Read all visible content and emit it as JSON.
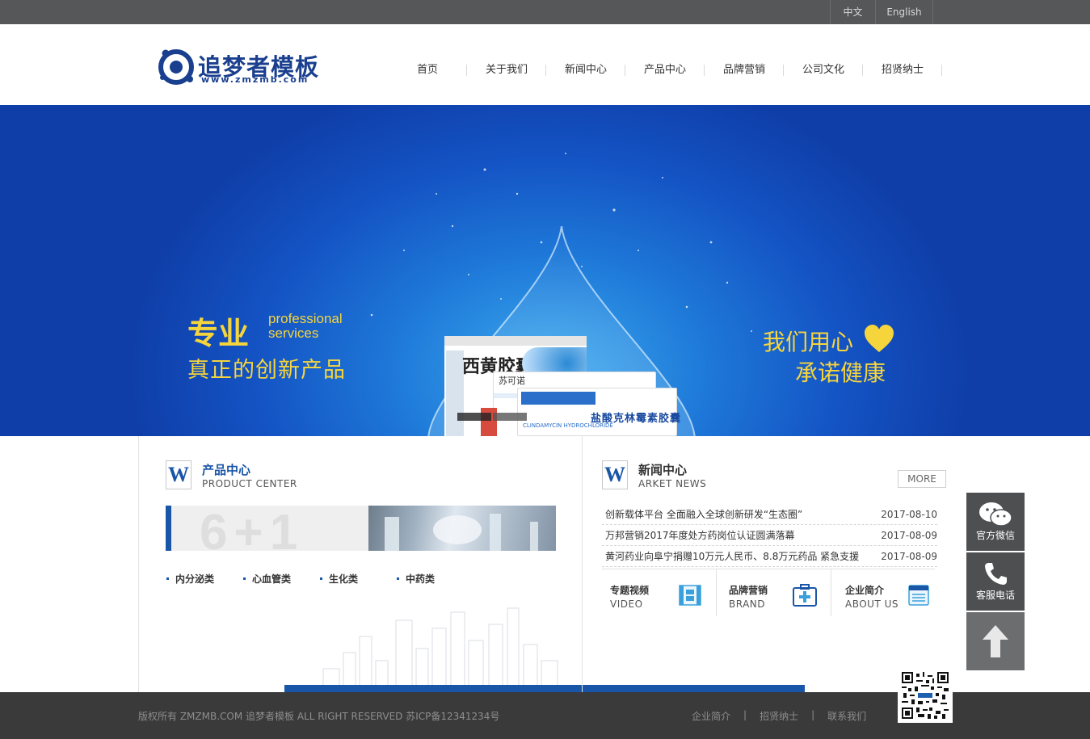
{
  "topbar": {
    "lang_zh": "中文",
    "lang_en": "English"
  },
  "header": {
    "logo_title": "追梦者模板",
    "logo_sub": "www.zmzmb.com",
    "nav": [
      "首页",
      "关于我们",
      "新闻中心",
      "产品中心",
      "品牌营销",
      "公司文化",
      "招贤纳士"
    ]
  },
  "banner": {
    "left_big": "专业",
    "left_en1": "professional",
    "left_en2": "services",
    "left_line2": "真正的创新产品",
    "right_line1": "我们用心",
    "right_line2": "承诺健康",
    "pkg1_name": "西黄胶囊",
    "pkg2_name": "苏可诺",
    "pkg3_name": "盐酸克林霉素胶囊",
    "pkg3_en": "CLINDAMYCIN HYDROCHLORIDE",
    "slides": 2,
    "active_slide": 1,
    "colors": {
      "accent": "#f6d53c",
      "bg_deep": "#0f3ea8",
      "bg_light": "#3aa8ee"
    }
  },
  "products": {
    "icon_letter": "W",
    "title": "产品中心",
    "subtitle": "PRODUCT CENTER",
    "banner_text": "6+1",
    "categories": [
      "内分泌类",
      "心血管类",
      "生化类",
      "中药类"
    ]
  },
  "news": {
    "icon_letter": "W",
    "title": "新闻中心",
    "subtitle": "ARKET NEWS",
    "more": "MORE",
    "items": [
      {
        "title": "创新载体平台 全面融入全球创新研发“生态圈”",
        "date": "2017-08-10"
      },
      {
        "title": "万邦营销2017年度处方药岗位认证圆满落幕",
        "date": "2017-08-09"
      },
      {
        "title": "黄河药业向阜宁捐赠10万元人民币、8.8万元药品 紧急支援",
        "date": "2017-08-09"
      }
    ],
    "links": [
      {
        "zh": "专题视频",
        "en": "VIDEO",
        "icon": "film-icon"
      },
      {
        "zh": "品牌营销",
        "en": "BRAND",
        "icon": "medical-kit-icon"
      },
      {
        "zh": "企业简介",
        "en": "ABOUT US",
        "icon": "document-icon"
      }
    ]
  },
  "side": {
    "wechat": "官方微信",
    "phone": "客服电话"
  },
  "footer": {
    "copyright": "版权所有 ZMZMB.COM 追梦者模板 ALL RIGHT RESERVED 苏ICP备12341234号",
    "links": [
      "企业简介",
      "招贤纳士",
      "联系我们"
    ],
    "sep": "|"
  }
}
